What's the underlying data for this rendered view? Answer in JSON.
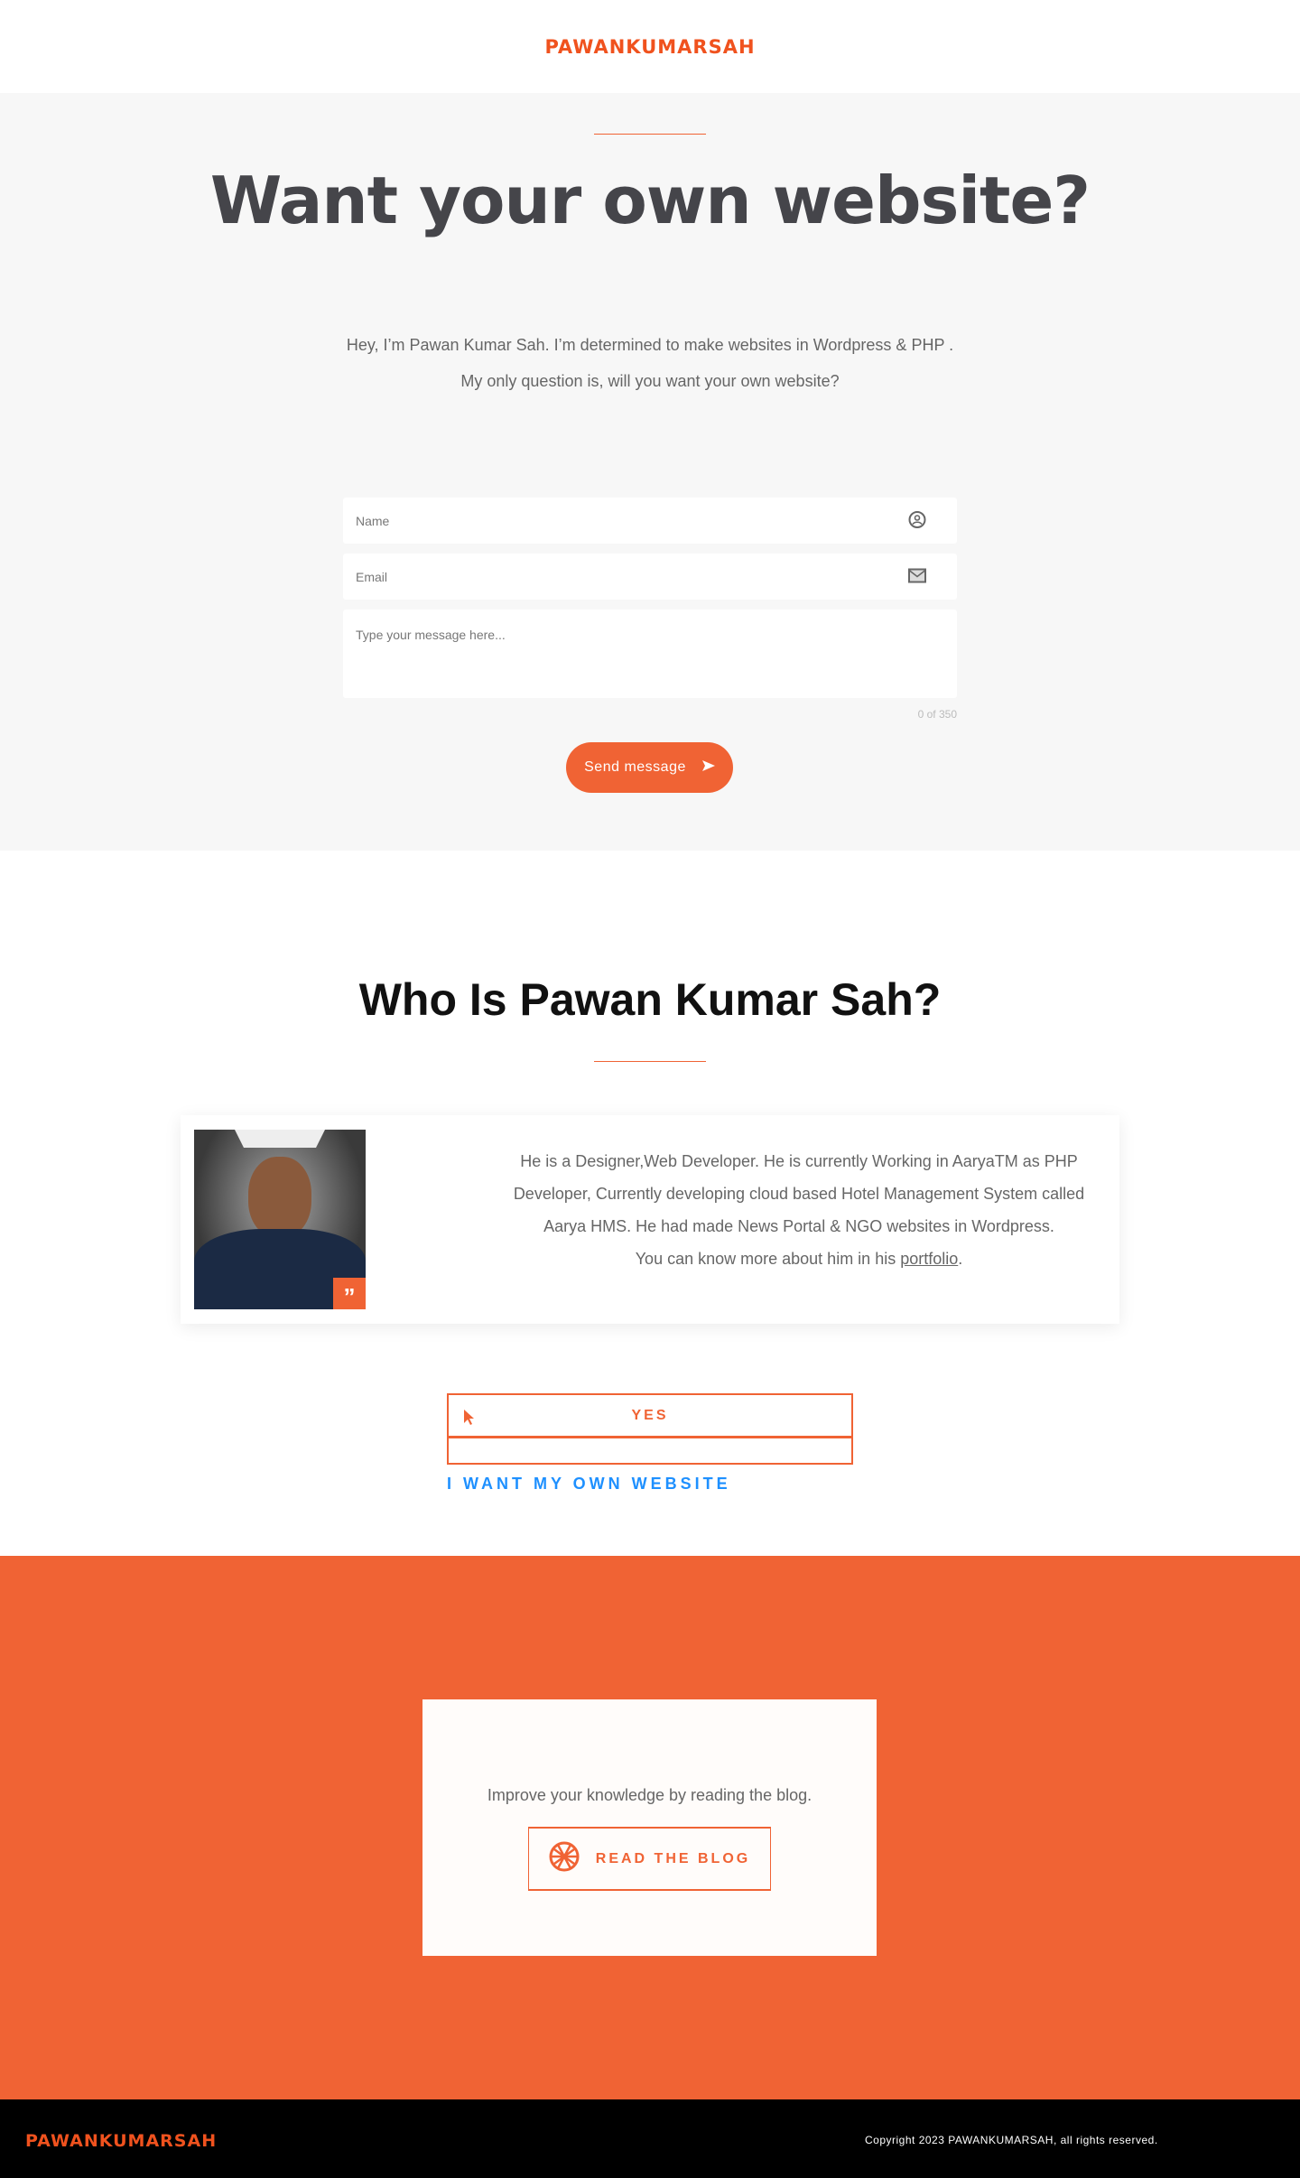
{
  "header": {
    "logo": "PAWANKUMARSAH"
  },
  "hero": {
    "title": "Want your own website?",
    "intro_line1": "Hey, I’m Pawan Kumar Sah. I’m determined to make websites in Wordpress & PHP .",
    "intro_line2": "My only question is, will you want your own website?"
  },
  "form": {
    "name_placeholder": "Name",
    "email_placeholder": "Email",
    "message_placeholder": "Type your message here...",
    "counter": "0 of 350",
    "send_label": "Send message"
  },
  "about": {
    "title": "Who Is Pawan Kumar Sah?",
    "bio": "He is a Designer,Web Developer. He is currently Working in AaryaTM as  PHP Developer, Currently developing cloud based Hotel Management System called Aarya HMS. He had made News Portal & NGO websites in Wordpress.",
    "portfolio_prefix": "You can know more about him in his ",
    "portfolio_link": "portfolio",
    "portfolio_suffix": ".",
    "quote_mark": "”"
  },
  "cta": {
    "yes_label": "YES",
    "want_label": "I WANT MY OWN WEBSITE"
  },
  "blog": {
    "text": "Improve your knowledge by reading the blog.",
    "button": "READ THE BLOG"
  },
  "footer": {
    "logo": "PAWANKUMARSAH",
    "copyright": "Copyright 2023 PAWANKUMARSAH, all rights reserved."
  },
  "colors": {
    "accent": "#f06334",
    "logo": "#f0521e",
    "link_blue": "#1e90ff",
    "footer_bg": "#000000"
  }
}
